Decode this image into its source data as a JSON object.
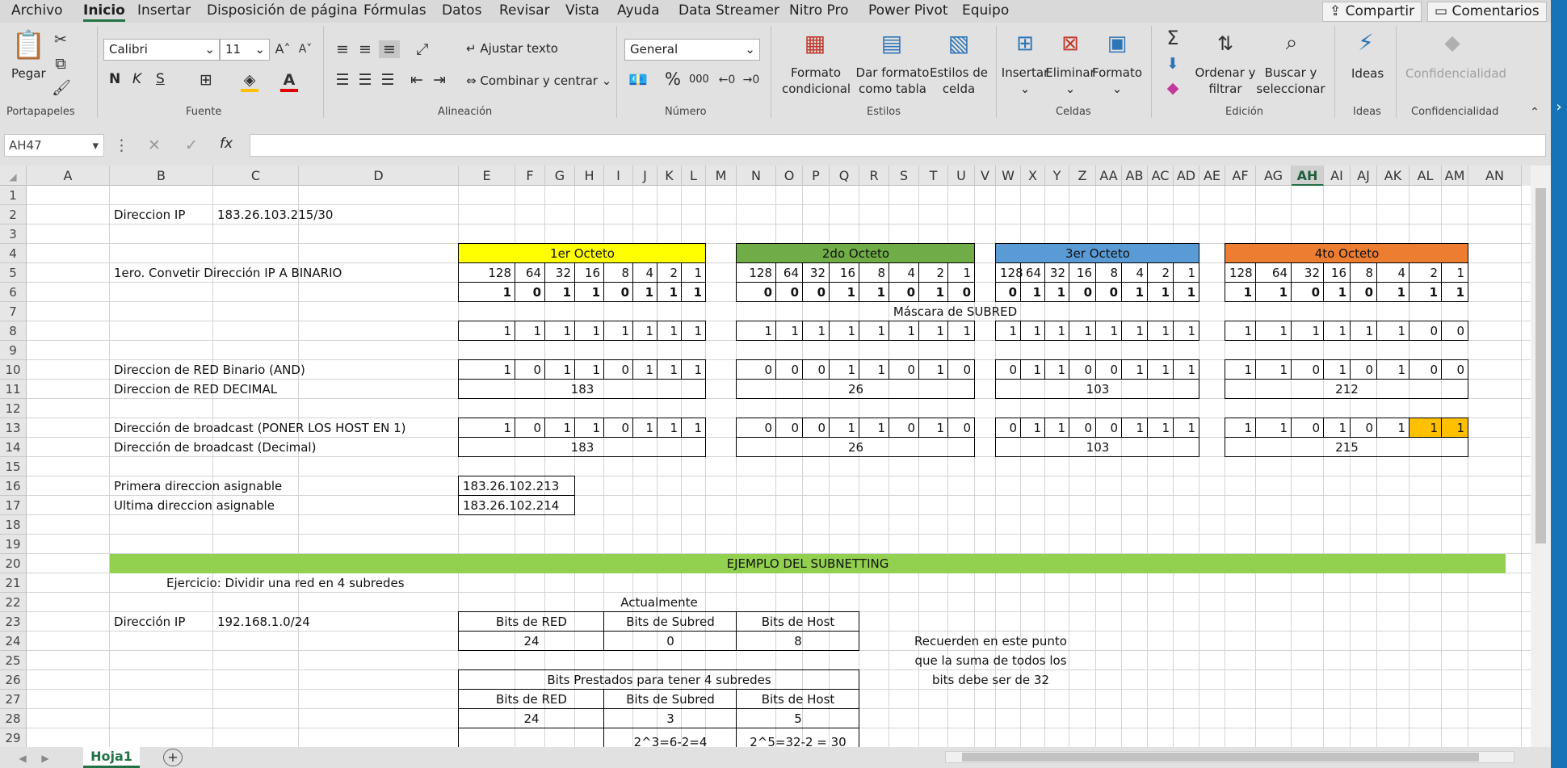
{
  "menu": {
    "tabs": [
      "Archivo",
      "Inicio",
      "Insertar",
      "Disposición de página",
      "Fórmulas",
      "Datos",
      "Revisar",
      "Vista",
      "Ayuda",
      "Data Streamer",
      "Nitro Pro",
      "Power Pivot",
      "Equipo"
    ],
    "share": "Compartir",
    "comments": "Comentarios"
  },
  "ribbon": {
    "paste": "Pegar",
    "clipboard_group": "Portapapeles",
    "font_name": "Calibri",
    "font_size": "11",
    "bold": "N",
    "italic": "K",
    "underline": "S",
    "font_group": "Fuente",
    "wrap_text": "Ajustar texto",
    "merge_center": "Combinar y centrar",
    "alignment_group": "Alineación",
    "number_format": "General",
    "number_group": "Número",
    "percent": "%",
    "thousands": "000",
    "cond_format_1": "Formato",
    "cond_format_2": "condicional",
    "format_table_1": "Dar formato",
    "format_table_2": "como tabla",
    "cell_styles_1": "Estilos de",
    "cell_styles_2": "celda",
    "styles_group": "Estilos",
    "insert": "Insertar",
    "delete": "Eliminar",
    "format": "Formato",
    "cells_group": "Celdas",
    "sort_1": "Ordenar y",
    "sort_2": "filtrar",
    "find_1": "Buscar y",
    "find_2": "seleccionar",
    "editing_group": "Edición",
    "ideas": "Ideas",
    "ideas_group": "Ideas",
    "confidential": "Confidencialidad",
    "confidential_group": "Confidencialidad"
  },
  "formula_bar": {
    "name_box": "AH47",
    "fx": "fx",
    "formula": ""
  },
  "columns": [
    "A",
    "B",
    "C",
    "D",
    "E",
    "F",
    "G",
    "H",
    "I",
    "J",
    "K",
    "L",
    "M",
    "N",
    "O",
    "P",
    "Q",
    "R",
    "S",
    "T",
    "U",
    "V",
    "W",
    "X",
    "Y",
    "Z",
    "AA",
    "AB",
    "AC",
    "AD",
    "AE",
    "AF",
    "AG",
    "AH",
    "AI",
    "AJ",
    "AK",
    "AL",
    "AM",
    "AN"
  ],
  "rows": [
    "1",
    "2",
    "3",
    "4",
    "5",
    "6",
    "7",
    "8",
    "9",
    "10",
    "11",
    "12",
    "13",
    "14",
    "15",
    "16",
    "17",
    "18",
    "19",
    "20",
    "21",
    "22",
    "23",
    "24",
    "25",
    "26",
    "27",
    "28",
    "29"
  ],
  "sheet": {
    "ip_label": "Direccion IP",
    "ip_value": "183.26.103.215/30",
    "octet_headers": [
      "1er Octeto",
      "2do Octeto",
      "3er Octeto",
      "4to Octeto"
    ],
    "step1": "1ero. Convetir Dirección IP A BINARIO",
    "weights": [
      "128",
      "64",
      "32",
      "16",
      "8",
      "4",
      "2",
      "1"
    ],
    "ip_binary": [
      [
        "1",
        "0",
        "1",
        "1",
        "0",
        "1",
        "1",
        "1"
      ],
      [
        "0",
        "0",
        "0",
        "1",
        "1",
        "0",
        "1",
        "0"
      ],
      [
        "0",
        "1",
        "1",
        "0",
        "0",
        "1",
        "1",
        "1"
      ],
      [
        "1",
        "1",
        "0",
        "1",
        "0",
        "1",
        "1",
        "1"
      ]
    ],
    "mask_title": "Máscara de SUBRED",
    "mask_binary": [
      [
        "1",
        "1",
        "1",
        "1",
        "1",
        "1",
        "1",
        "1"
      ],
      [
        "1",
        "1",
        "1",
        "1",
        "1",
        "1",
        "1",
        "1"
      ],
      [
        "1",
        "1",
        "1",
        "1",
        "1",
        "1",
        "1",
        "1"
      ],
      [
        "1",
        "1",
        "1",
        "1",
        "1",
        "1",
        "0",
        "0"
      ]
    ],
    "net_bin_label": "Direccion de RED Binario (AND)",
    "net_binary": [
      [
        "1",
        "0",
        "1",
        "1",
        "0",
        "1",
        "1",
        "1"
      ],
      [
        "0",
        "0",
        "0",
        "1",
        "1",
        "0",
        "1",
        "0"
      ],
      [
        "0",
        "1",
        "1",
        "0",
        "0",
        "1",
        "1",
        "1"
      ],
      [
        "1",
        "1",
        "0",
        "1",
        "0",
        "1",
        "0",
        "0"
      ]
    ],
    "net_dec_label": "Direccion de RED DECIMAL",
    "net_decimal": [
      "183",
      "26",
      "103",
      "212"
    ],
    "bc_bin_label": "Dirección de broadcast (PONER LOS HOST EN 1)",
    "bc_binary": [
      [
        "1",
        "0",
        "1",
        "1",
        "0",
        "1",
        "1",
        "1"
      ],
      [
        "0",
        "0",
        "0",
        "1",
        "1",
        "0",
        "1",
        "0"
      ],
      [
        "0",
        "1",
        "1",
        "0",
        "0",
        "1",
        "1",
        "1"
      ],
      [
        "1",
        "1",
        "0",
        "1",
        "0",
        "1",
        "1",
        "1"
      ]
    ],
    "bc_dec_label": "Dirección de broadcast (Decimal)",
    "bc_decimal": [
      "183",
      "26",
      "103",
      "215"
    ],
    "first_label": "Primera direccion asignable",
    "first_value": "183.26.102.213",
    "last_label": "Ultima direccion asignable",
    "last_value": "183.26.102.214",
    "subnet_banner": "EJEMPLO DEL SUBNETTING",
    "exercise": "Ejercicio: Dividir una red en 4 subredes",
    "currently": "Actualmente",
    "ip2_label": "Dirección IP",
    "ip2_value": "192.168.1.0/24",
    "bits_headers": [
      "Bits de RED",
      "Bits de Subred",
      "Bits de Host"
    ],
    "current_bits": [
      "24",
      "0",
      "8"
    ],
    "note_lines": [
      "Recuerden en este punto",
      "que la suma de  todos los",
      "bits debe ser de 32"
    ],
    "borrowed_title": "Bits Prestados para tener 4 subredes",
    "borrowed_bits": [
      "24",
      "3",
      "5"
    ],
    "calc": [
      "2^3=6-2=4",
      "2^5=32-2 = 30"
    ]
  },
  "sheet_tab": "Hoja1",
  "colors": {
    "octet1": "#ffff00",
    "octet2": "#70ad47",
    "octet3": "#5b9bd5",
    "octet4": "#ed7d31",
    "highlight": "#ffc000",
    "banner": "#92d050",
    "excel_green": "#217346"
  }
}
